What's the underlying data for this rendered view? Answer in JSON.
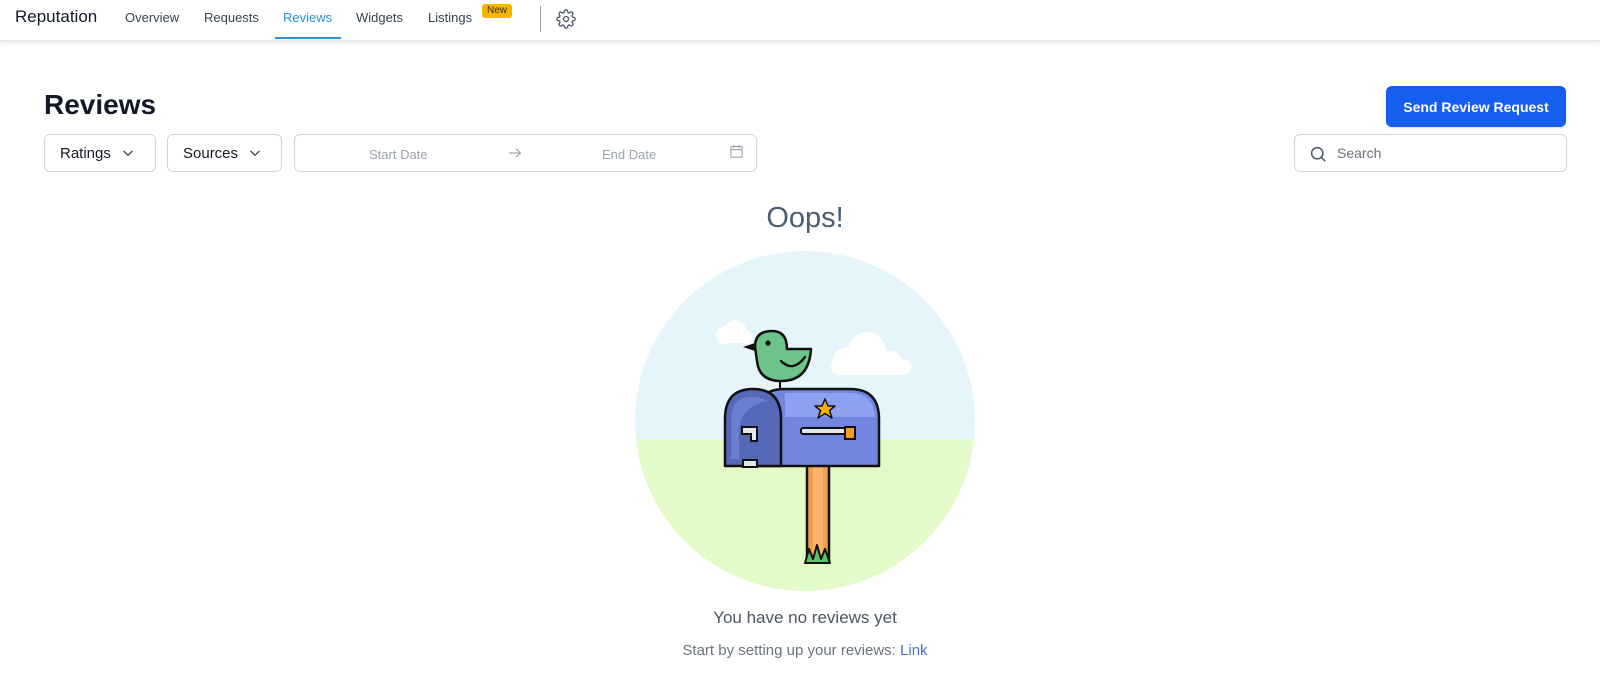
{
  "app": {
    "title": "Reputation"
  },
  "nav": {
    "items": [
      {
        "label": "Overview"
      },
      {
        "label": "Requests"
      },
      {
        "label": "Reviews",
        "active": true
      },
      {
        "label": "Widgets"
      },
      {
        "label": "Listings",
        "badge": "New"
      }
    ],
    "settings_icon": "gear-icon"
  },
  "header": {
    "title": "Reviews",
    "send_button": "Send Review Request"
  },
  "filters": {
    "ratings": "Ratings",
    "sources": "Sources",
    "start_date_placeholder": "Start Date",
    "end_date_placeholder": "End Date",
    "search_placeholder": "Search"
  },
  "empty_state": {
    "title": "Oops!",
    "message": "You have no reviews yet",
    "sub_text": "Start by setting up your reviews:",
    "link_text": "Link",
    "illustration": "mailbox-with-bird"
  },
  "colors": {
    "accent": "#155eef",
    "active_tab": "#2b8fd9",
    "badge": "#f6b500"
  }
}
